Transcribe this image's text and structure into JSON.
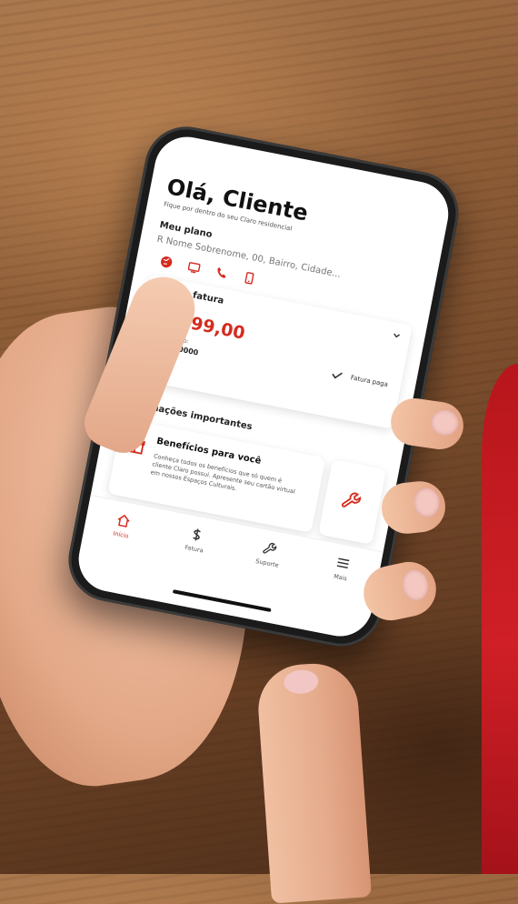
{
  "greeting": "Olá, Cliente",
  "subtitle": "Fique por dentro do seu Claro residencial",
  "plan": {
    "label": "Meu plano",
    "address": "R Nome Sobrenome, 00, Bairro, Cidade...",
    "icons": [
      "globe-icon",
      "tv-icon",
      "phone-icon",
      "mobile-icon"
    ]
  },
  "invoice": {
    "label": "Última fatura",
    "amount": "R$ 99,00",
    "due_label": "Vencimento:",
    "due_date": "00/00/0000",
    "status": "Fatura paga"
  },
  "info": {
    "title": "Informações importantes",
    "benefit_title": "Benefícios para você",
    "benefit_text": "Conheça todos os benefícios que só quem é cliente Claro possui. Apresente seu cartão virtual em nossos Espaços Culturais."
  },
  "nav": {
    "home": "Início",
    "invoice": "Fatura",
    "support": "Suporte",
    "more": "Mais"
  },
  "colors": {
    "accent": "#d52b1e"
  }
}
